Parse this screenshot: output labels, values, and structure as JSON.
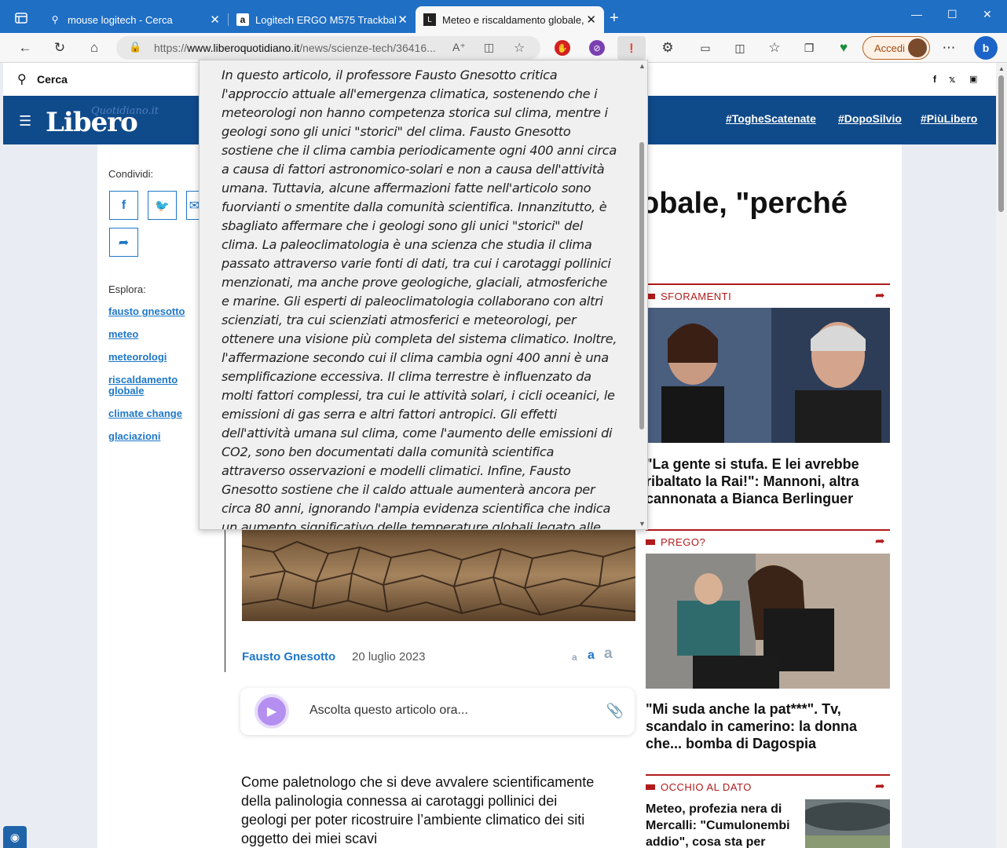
{
  "browser": {
    "tabs": [
      {
        "title": "mouse logitech - Cerca",
        "icon": "search-icon",
        "active": false
      },
      {
        "title": "Logitech ERGO M575 Trackball -",
        "icon": "amazon-icon",
        "active": false
      },
      {
        "title": "Meteo e riscaldamento globale, '",
        "icon": "libero-favicon",
        "active": true
      }
    ],
    "url_prefix": "https://",
    "url_domain": "www.liberoquotidiano.it",
    "url_path": "/news/scienze-tech/36416...",
    "login_label": "Accedi"
  },
  "site": {
    "search_label": "Cerca",
    "logo_main": "Libero",
    "logo_sub": "Quotidiano.it",
    "header_tags": [
      "#TogheScatenate",
      "#DopoSilvio",
      "#PiùLibero"
    ],
    "social_icons": [
      "f",
      "t",
      "ig"
    ]
  },
  "sidebar": {
    "share_label": "Condividi:",
    "explore_label": "Esplora:",
    "tags": [
      "fausto gnesotto",
      "meteo",
      "meteorologi",
      "riscaldamento globale",
      "climate change",
      "glaciazioni"
    ]
  },
  "article": {
    "headline_fragment": "obale, \"perché",
    "author": "Fausto Gnesotto",
    "date": "20 luglio 2023",
    "font_sizes": [
      "a",
      "a",
      "a"
    ],
    "player_label": "Ascolta questo articolo ora...",
    "body": "Come paletnologo che si deve avvalere scientificamente della palinologia connessa ai carotaggi pollinici dei geologi per poter ricostruire l’ambiente climatico dei siti oggetto dei miei scavi"
  },
  "right_column": [
    {
      "category": "SFORAMENTI",
      "title": "\"La gente si stufa. E lei avrebbe ribaltato la Rai!\": Mannoni, altra cannonata a Bianca Berlinguer"
    },
    {
      "category": "PREGO?",
      "title": "\"Mi suda anche la pat***\". Tv, scandalo in camerino: la donna che... bomba di Dagospia"
    },
    {
      "category": "OCCHIO AL DATO",
      "title": "Meteo, profezia nera di Mercalli: \"Cumulonembi addio\", cosa sta per"
    }
  ],
  "popup": {
    "text": "In questo articolo, il professore Fausto Gnesotto critica l'approccio attuale all'emergenza climatica, sostenendo che i meteorologi non hanno competenza storica sul clima, mentre i geologi sono gli unici \"storici\" del clima. Fausto Gnesotto sostiene che il clima cambia periodicamente ogni 400 anni circa a causa di fattori astronomico-solari e non a causa dell'attività umana. Tuttavia, alcune affermazioni fatte nell'articolo sono fuorvianti o smentite dalla comunità scientifica. Innanzitutto, è sbagliato affermare che i geologi sono gli unici \"storici\" del clima. La paleoclimatologia è una scienza che studia il clima passato attraverso varie fonti di dati, tra cui i carotaggi pollinici menzionati, ma anche prove geologiche, glaciali, atmosferiche e marine. Gli esperti di paleoclimatologia collaborano con altri scienziati, tra cui scienziati atmosferici e meteorologi, per ottenere una visione più completa del sistema climatico. Inoltre, l'affermazione secondo cui il clima cambia ogni 400 anni è una semplificazione eccessiva. Il clima terrestre è influenzato da molti fattori complessi, tra cui le attività solari, i cicli oceanici, le emissioni di gas serra e altri fattori antropici. Gli effetti dell'attività umana sul clima, come l'aumento delle emissioni di CO2, sono ben documentati dalla comunità scientifica attraverso osservazioni e modelli climatici. Infine, Fausto Gnesotto sostiene che il caldo attuale aumenterà ancora per circa 80 anni, ignorando l'ampia evidenza scientifica che indica un aumento significativo delle temperature globali legato alle"
  },
  "colors": {
    "titlebar": "#1f6fc5",
    "libero_blue": "#0f4a8a",
    "link_blue": "#1f78c8",
    "section_red": "#b11b1b"
  }
}
